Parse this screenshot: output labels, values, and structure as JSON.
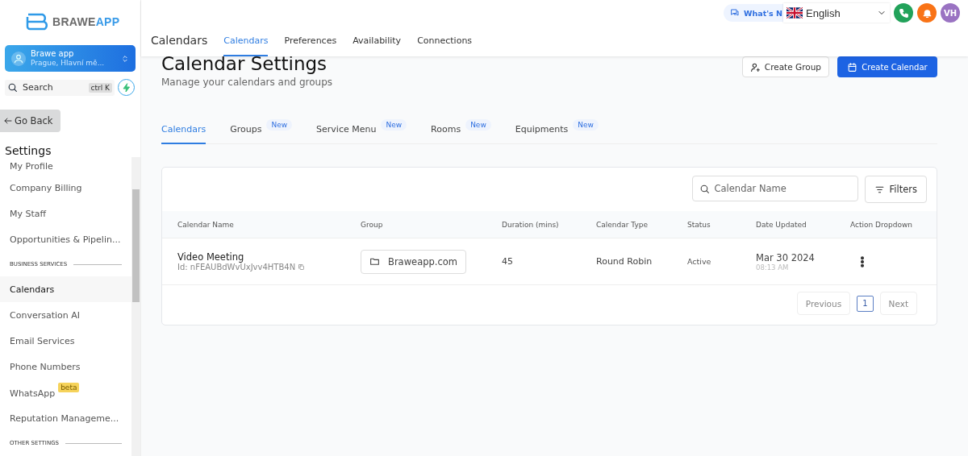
{
  "sidebar": {
    "logo": "BRAWEAPP",
    "account": {
      "name": "Brawe app",
      "location": "Prague, Hlavní mě..."
    },
    "search": {
      "placeholder": "Search",
      "shortcut": "ctrl K"
    },
    "back": "Go Back",
    "title": "Settings",
    "items": [
      {
        "kind": "item",
        "label": "My Profile",
        "selected": false
      },
      {
        "kind": "item",
        "label": "Company Billing",
        "selected": false
      },
      {
        "kind": "item",
        "label": "My Staff",
        "selected": false
      },
      {
        "kind": "item",
        "label": "Opportunities & Pipelin...",
        "selected": false
      },
      {
        "kind": "section",
        "label": "BUSINESS SERVICES"
      },
      {
        "kind": "item",
        "label": "Calendars",
        "selected": true
      },
      {
        "kind": "item",
        "label": "Conversation AI",
        "selected": false
      },
      {
        "kind": "item",
        "label": "Email Services",
        "selected": false
      },
      {
        "kind": "item",
        "label": "Phone Numbers",
        "selected": false
      },
      {
        "kind": "item",
        "label": "WhatsApp",
        "badge": "beta",
        "selected": false
      },
      {
        "kind": "item",
        "label": "Reputation Manageme...",
        "selected": false
      },
      {
        "kind": "section",
        "label": "OTHER SETTINGS"
      }
    ]
  },
  "header": {
    "title": "Calendars",
    "tabs": [
      {
        "label": "Calendars",
        "selected": true
      },
      {
        "label": "Preferences",
        "selected": false
      },
      {
        "label": "Availability",
        "selected": false
      },
      {
        "label": "Connections",
        "selected": false
      }
    ],
    "whats_new": "What's N",
    "language": "English",
    "avatar": "VH"
  },
  "page": {
    "title": "Calendar Settings",
    "subtitle": "Manage your calendars and groups",
    "buttons": [
      {
        "kind": "secondary",
        "label": "Create Group"
      },
      {
        "kind": "primary",
        "label": "Create Calendar"
      }
    ],
    "tabs": [
      {
        "label": "Calendars",
        "selected": true
      },
      {
        "label": "Groups",
        "badge": "New",
        "selected": false
      },
      {
        "label": "Service Menu",
        "badge": "New",
        "selected": false
      },
      {
        "label": "Rooms",
        "badge": "New",
        "selected": false
      },
      {
        "label": "Equipments",
        "badge": "New",
        "selected": false
      }
    ]
  },
  "table": {
    "search": {
      "placeholder": "Calendar Name"
    },
    "filters": "Filters",
    "columns": [
      "Calendar Name",
      "Group",
      "Duration (mins)",
      "Calendar Type",
      "Status",
      "Date Updated",
      "Action Dropdown"
    ],
    "rows": [
      {
        "name": "Video Meeting",
        "id": "Id: nFEAUBdWvUxJvv4HTB4N",
        "group": "Braweapp.com",
        "duration": "45",
        "type": "Round Robin",
        "status": "Active",
        "date": "Mar 30 2024",
        "time": "08:13 AM"
      }
    ],
    "pagination": {
      "previous": "Previous",
      "pages": [
        {
          "label": "1",
          "selected": true
        }
      ],
      "next": "Next"
    }
  }
}
